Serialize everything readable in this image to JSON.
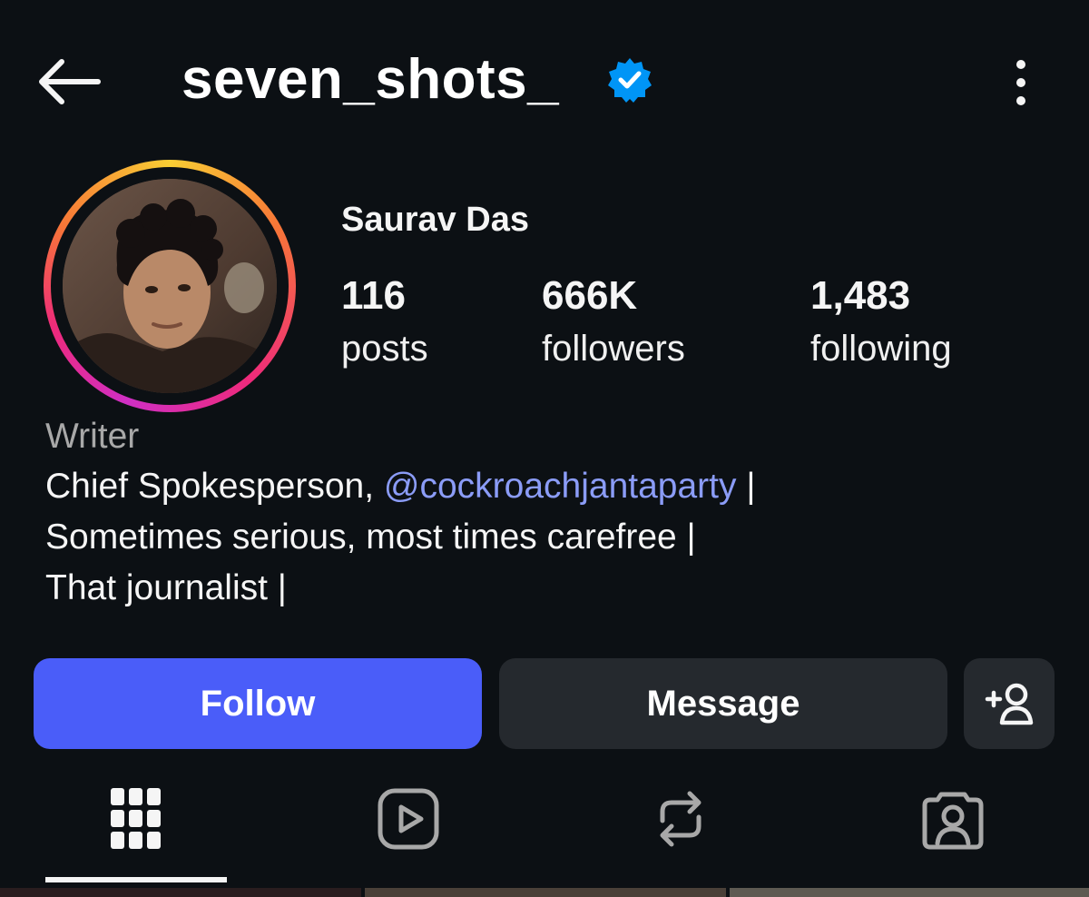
{
  "header": {
    "username": "seven_shots_",
    "verified": true,
    "back_icon": "arrow-left-icon",
    "more_icon": "more-vertical-icon"
  },
  "profile": {
    "display_name": "Saurav Das",
    "stats": [
      {
        "value": "116",
        "label": "posts"
      },
      {
        "value": "666K",
        "label": "followers"
      },
      {
        "value": "1,483",
        "label": "following"
      }
    ],
    "category": "Writer",
    "bio": {
      "line1_prefix": "Chief Spokesperson, ",
      "threads_glyph": "@",
      "mention": "cockroachjantaparty",
      "line1_suffix": " |",
      "line2": "Sometimes serious, most times carefree |",
      "line3": "That journalist |"
    }
  },
  "actions": {
    "follow_label": "Follow",
    "message_label": "Message",
    "add_icon": "add-person-icon"
  },
  "tabs": [
    {
      "name": "grid",
      "icon": "grid-icon",
      "active": true
    },
    {
      "name": "reels",
      "icon": "reels-play-icon",
      "active": false
    },
    {
      "name": "reposts",
      "icon": "repost-icon",
      "active": false
    },
    {
      "name": "tagged",
      "icon": "tagged-person-icon",
      "active": false
    }
  ],
  "colors": {
    "background": "#0c1014",
    "follow_button": "#4a5df9",
    "secondary_button": "#25292e",
    "mention": "#8b9cf7",
    "verified_badge": "#0095f6",
    "muted_text": "#a8a8a8"
  }
}
